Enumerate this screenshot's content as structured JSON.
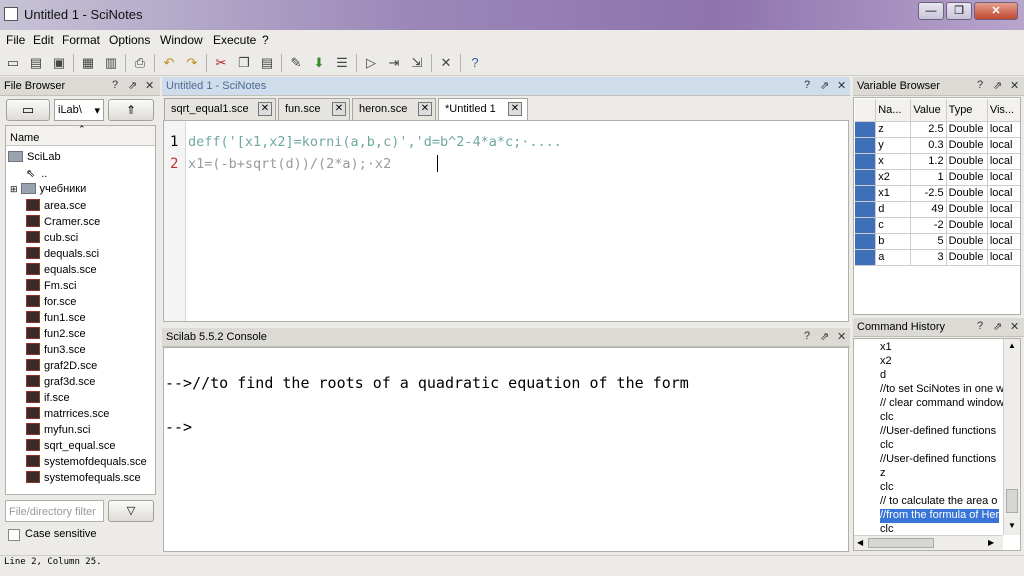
{
  "window": {
    "title": "Untitled 1 - SciNotes",
    "buttons": [
      "—",
      "❐",
      "✕"
    ]
  },
  "menu": [
    "File",
    "Edit",
    "Format",
    "Options",
    "Window",
    "Execute",
    "?"
  ],
  "toolbar_icons": [
    "new-file-icon",
    "open-icon",
    "save-icon",
    "save-as-icon",
    "print-preview-icon",
    "print-icon",
    "undo-icon",
    "redo-icon",
    "cut-icon",
    "copy-icon",
    "paste-icon",
    "edit-icon",
    "execute-icon",
    "run-icon",
    "run-file-icon",
    "run-from-icon",
    "run-to-icon",
    "tools-icon",
    "help-icon"
  ],
  "file_browser": {
    "title": "File Browser",
    "path_label": "iLab\\",
    "column_name": "Name",
    "root": "SciLab",
    "parent": "..",
    "folder": "учебники",
    "files": [
      "area.sce",
      "Cramer.sce",
      "cub.sci",
      "dequals.sci",
      "equals.sce",
      "Fm.sci",
      "for.sce",
      "fun1.sce",
      "fun2.sce",
      "fun3.sce",
      "graf2D.sce",
      "graf3d.sce",
      "if.sce",
      "matrrices.sce",
      "myfun.sci",
      "sqrt_equal.sce",
      "systemofdequals.sce",
      "systemofequals.sce"
    ],
    "filter_placeholder": "File/directory filter",
    "case_sensitive_label": "Case sensitive"
  },
  "editor": {
    "title": "Untitled 1 - SciNotes",
    "tabs": [
      "sqrt_equal1.sce",
      "fun.sce",
      "heron.sce",
      "*Untitled 1"
    ],
    "lines": [
      {
        "num": "1",
        "text": "deff('[x1,x2]=korni(a,b,c)','d=b^2-4*a*c;·....",
        "color": "#6fa8a0"
      },
      {
        "num": "2",
        "text": "x1=(-b+sqrt(d))/(2*a);·x2",
        "color": "#9a9a9a"
      }
    ]
  },
  "console": {
    "title": "Scilab 5.5.2 Console",
    "lines": [
      "-->//to find the roots of a quadratic equation of the form",
      "-->"
    ]
  },
  "variable_browser": {
    "title": "Variable Browser",
    "columns": [
      "Na...",
      "Value",
      "Type",
      "Vis..."
    ],
    "rows": [
      [
        "z",
        "2.5",
        "Double",
        "local"
      ],
      [
        "y",
        "0.3",
        "Double",
        "local"
      ],
      [
        "x",
        "1.2",
        "Double",
        "local"
      ],
      [
        "x2",
        "1",
        "Double",
        "local"
      ],
      [
        "x1",
        "-2.5",
        "Double",
        "local"
      ],
      [
        "d",
        "49",
        "Double",
        "local"
      ],
      [
        "c",
        "-2",
        "Double",
        "local"
      ],
      [
        "b",
        "5",
        "Double",
        "local"
      ],
      [
        "a",
        "3",
        "Double",
        "local"
      ]
    ]
  },
  "command_history": {
    "title": "Command History",
    "items": [
      "x1",
      "x2",
      "d",
      "//to set SciNotes in one w",
      "// clear command window",
      "clc",
      "//User-defined functions",
      "clc",
      "//User-defined functions",
      "z",
      "clc",
      "// to calculate the area o",
      "//from the formula of Her",
      "clc"
    ],
    "selected_index": 12
  },
  "status": "Line 2, Column 25."
}
